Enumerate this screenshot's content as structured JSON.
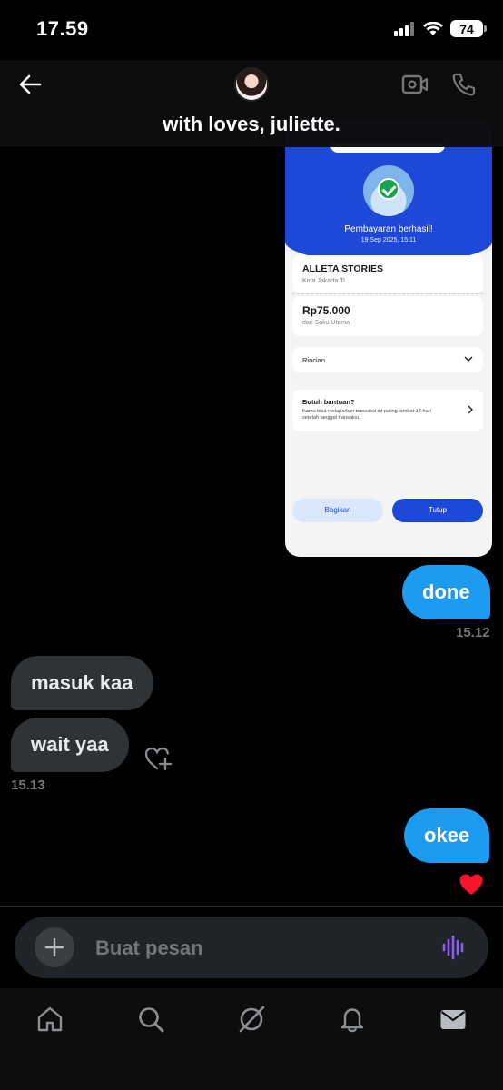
{
  "status_bar": {
    "time": "17.59",
    "battery": "74"
  },
  "header": {
    "title": "with loves, juliette."
  },
  "receipt": {
    "status": "Pembayaran berhasil!",
    "datetime": "19 Sep 2025, 15:11",
    "merchant_name": "ALLETA STORIES",
    "merchant_city": "Kota Jakarta Ti",
    "amount": "Rp75.000",
    "source": "dari Saku Utama",
    "details_label": "Rincian",
    "help_title": "Butuh bantuan?",
    "help_text": "Kamu bisa melaporkan transaksi ini paling lambat 14 hari setelah tanggal transaksi.",
    "share_label": "Bagikan",
    "close_label": "Tutup",
    "brand_color": "#1e49d8"
  },
  "messages": [
    {
      "text": "done",
      "direction": "out"
    },
    {
      "text": "masuk kaa",
      "direction": "in"
    },
    {
      "text": "wait yaa",
      "direction": "in"
    },
    {
      "text": "okee",
      "direction": "out",
      "reaction": "heart"
    }
  ],
  "timestamps": {
    "done": "15.12",
    "wait": "15.13"
  },
  "composer": {
    "placeholder": "Buat pesan"
  },
  "nav": {
    "items": [
      "home-icon",
      "search-icon",
      "grok-icon",
      "notifications-icon",
      "messages-icon"
    ]
  },
  "colors": {
    "bubble_out": "#1d9bf0",
    "bubble_in": "#2f3336",
    "voice": "#8b5cf6"
  }
}
